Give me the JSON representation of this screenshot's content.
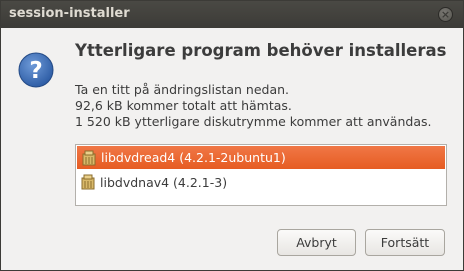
{
  "window": {
    "title": "session-installer",
    "close_symbol": "×"
  },
  "dialog": {
    "icon": "question-icon",
    "heading": "Ytterligare program behöver installeras",
    "message_lines": [
      "Ta en titt på ändringslistan nedan.",
      "92,6 kB kommer totalt att hämtas.",
      "1 520 kB ytterligare diskutrymme kommer att användas."
    ]
  },
  "packages": {
    "items": [
      {
        "label": "libdvdread4 (4.2.1-2ubuntu1)",
        "icon": "package-icon",
        "selected": true
      },
      {
        "label": "libdvdnav4 (4.2.1-3)",
        "icon": "package-icon",
        "selected": false
      }
    ]
  },
  "actions": {
    "cancel_label": "Avbryt",
    "continue_label": "Fortsätt"
  },
  "colors": {
    "titlebar": "#3c3b37",
    "selection": "#e9622a",
    "question_icon": "#3a6fb8"
  }
}
